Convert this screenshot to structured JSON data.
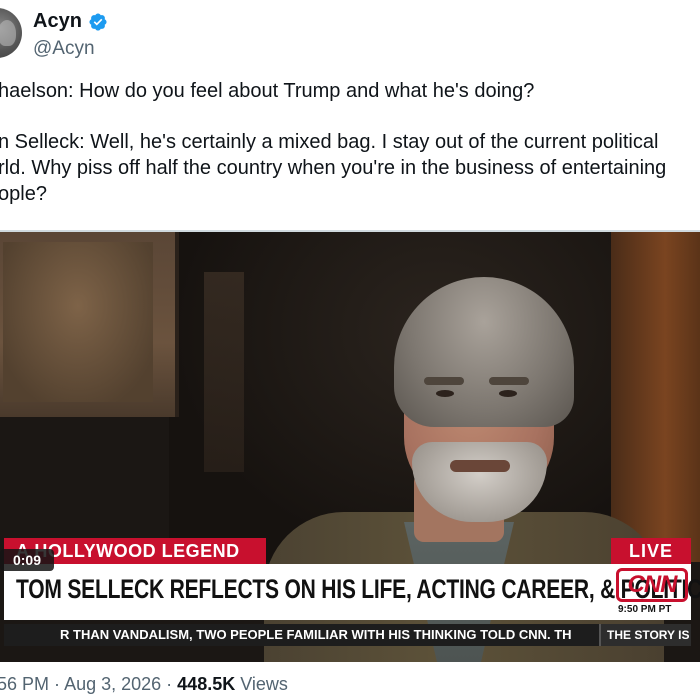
{
  "author": {
    "display_name": "Acyn",
    "handle": "@Acyn",
    "verified": true
  },
  "tweet": {
    "lines_p1": [
      "haelson: How do you feel about Trump and what he's doing?"
    ],
    "lines_p2": [
      "n Selleck: Well, he's certainly a mixed bag. I stay out of the current political",
      "rld. Why piss off half the country when you're in the business of entertaining",
      "ople?"
    ]
  },
  "video": {
    "timer": "0:09",
    "lower_third": {
      "tag": "A HOLLYWOOD LEGEND",
      "live": "LIVE",
      "headline": "TOM SELLECK REFLECTS ON HIS LIFE, ACTING CAREER, & POLITICS",
      "network": "CNN",
      "time": "9:50 PM PT",
      "ticker": "R THAN VANDALISM, TWO PEOPLE FAMILIAR WITH HIS THINKING TOLD CNN. TH",
      "ticker_end": "THE STORY IS"
    }
  },
  "meta": {
    "time": "56 PM",
    "date": "Aug 3, 2026",
    "views_count": "448.5K",
    "views_label": "Views"
  },
  "colors": {
    "cnn_red": "#c8102e",
    "verified_blue": "#1d9bf0",
    "secondary_text": "#536471"
  }
}
